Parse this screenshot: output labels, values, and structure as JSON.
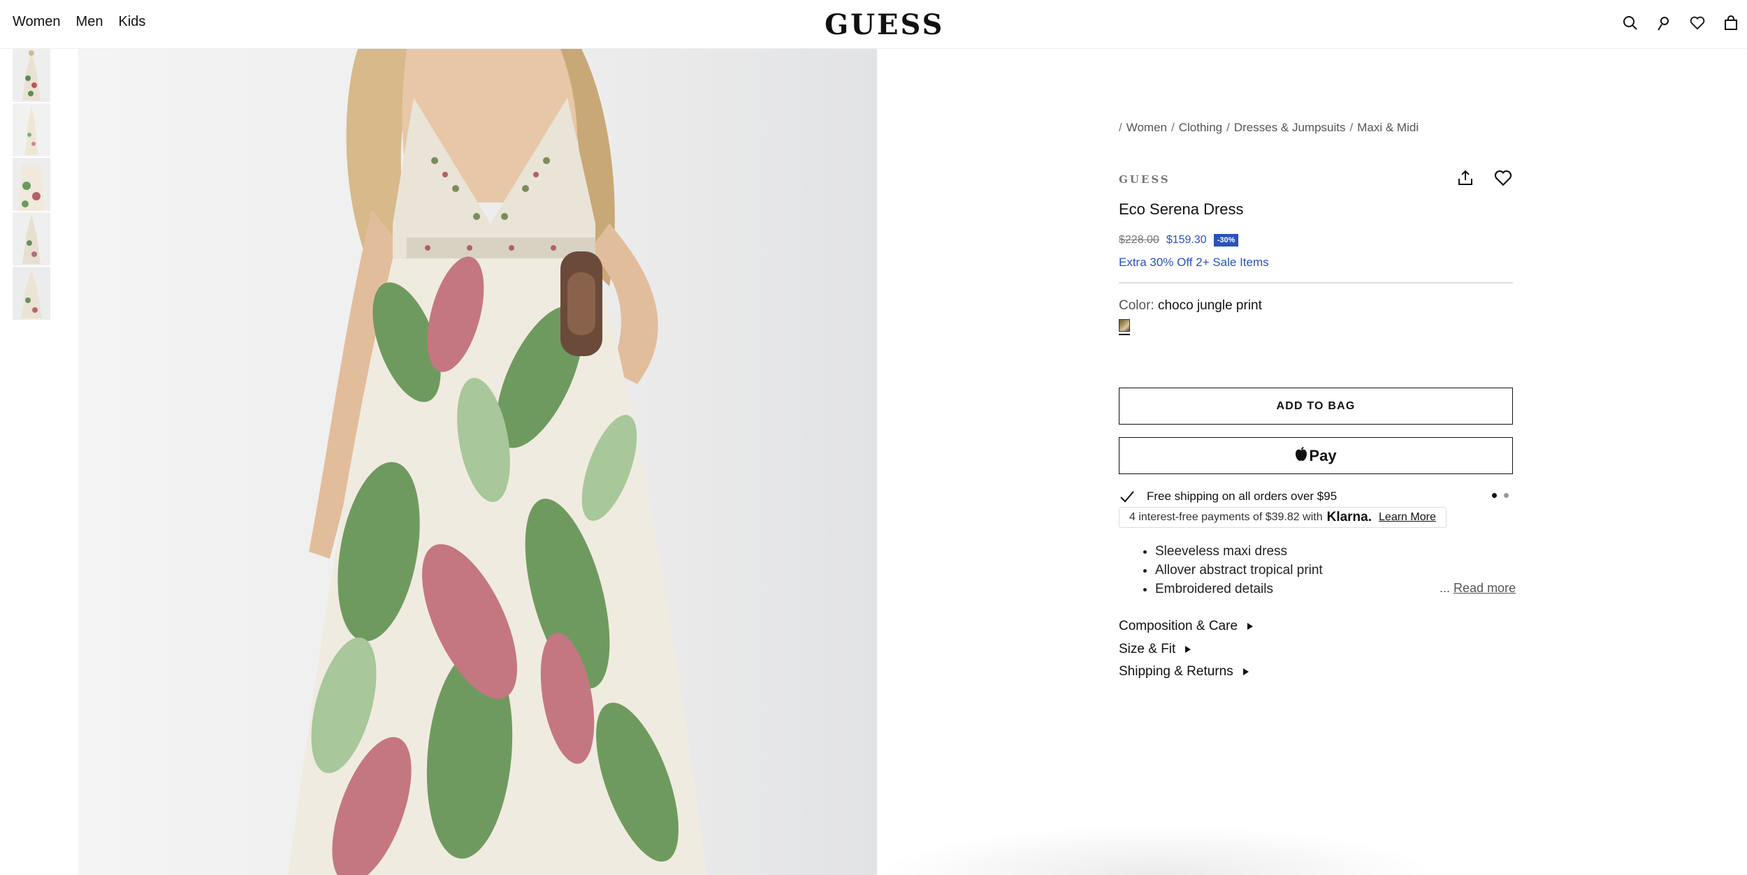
{
  "header": {
    "nav": [
      "Women",
      "Men",
      "Kids"
    ],
    "logo": "GUESS",
    "icons": [
      "search-icon",
      "account-icon",
      "wishlist-icon",
      "bag-icon"
    ]
  },
  "gallery": {
    "thumbnail_count": 5,
    "main_image": "model wearing floral maxi dress"
  },
  "product": {
    "breadcrumb": [
      "Women",
      "Clothing",
      "Dresses & Jumpsuits",
      "Maxi & Midi"
    ],
    "brand": "GUESS",
    "title": "Eco Serena Dress",
    "price_original": "$228.00",
    "price_sale": "$159.30",
    "discount_badge": "-30%",
    "promo": "Extra 30% Off 2+ Sale Items",
    "color_label": "Color:",
    "color_value": "choco jungle print",
    "add_to_bag": "ADD TO BAG",
    "apple_pay": "Pay",
    "shipping_text": "Free shipping on all orders over $95",
    "klarna_text": "4 interest-free payments of $39.82 with",
    "klarna_brand": "Klarna.",
    "klarna_link": "Learn More",
    "features": [
      "Sleeveless maxi dress",
      "Allover abstract tropical print",
      "Embroidered details"
    ],
    "read_more_ellipsis": "...",
    "read_more": "Read more",
    "accordions": [
      "Composition & Care",
      "Size & Fit",
      "Shipping & Returns"
    ]
  },
  "colors": {
    "accent": "#2a52be",
    "text": "#111111"
  }
}
